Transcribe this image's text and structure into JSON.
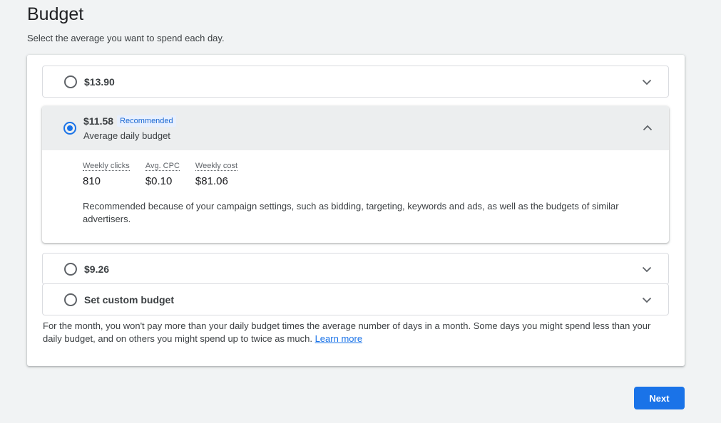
{
  "page": {
    "title": "Budget",
    "subtitle": "Select the average you want to spend each day."
  },
  "options": [
    {
      "label": "$13.90",
      "selected": false,
      "expanded": false
    },
    {
      "label": "$11.58",
      "selected": true,
      "expanded": true,
      "badge": "Recommended",
      "sub_label": "Average daily budget",
      "metrics": [
        {
          "label": "Weekly clicks",
          "value": "810"
        },
        {
          "label": "Avg. CPC",
          "value": "$0.10"
        },
        {
          "label": "Weekly cost",
          "value": "$81.06"
        }
      ],
      "reason": "Recommended because of your campaign settings, such as bidding, targeting, keywords and ads, as well as the budgets of similar advertisers."
    },
    {
      "label": "$9.26",
      "selected": false,
      "expanded": false
    },
    {
      "label": "Set custom budget",
      "selected": false,
      "expanded": false
    }
  ],
  "footnote": {
    "text": "For the month, you won't pay more than your daily budget times the average number of days in a month. Some days you might spend less than your daily budget, and on others you might spend up to twice as much.",
    "link": "Learn more"
  },
  "actions": {
    "next_label": "Next"
  },
  "colors": {
    "accent": "#1a73e8",
    "background": "#f1f3f4",
    "badge_bg": "#e8f0fe"
  },
  "icons": {
    "collapsed": "chevron-down-icon",
    "expanded": "chevron-up-icon"
  }
}
